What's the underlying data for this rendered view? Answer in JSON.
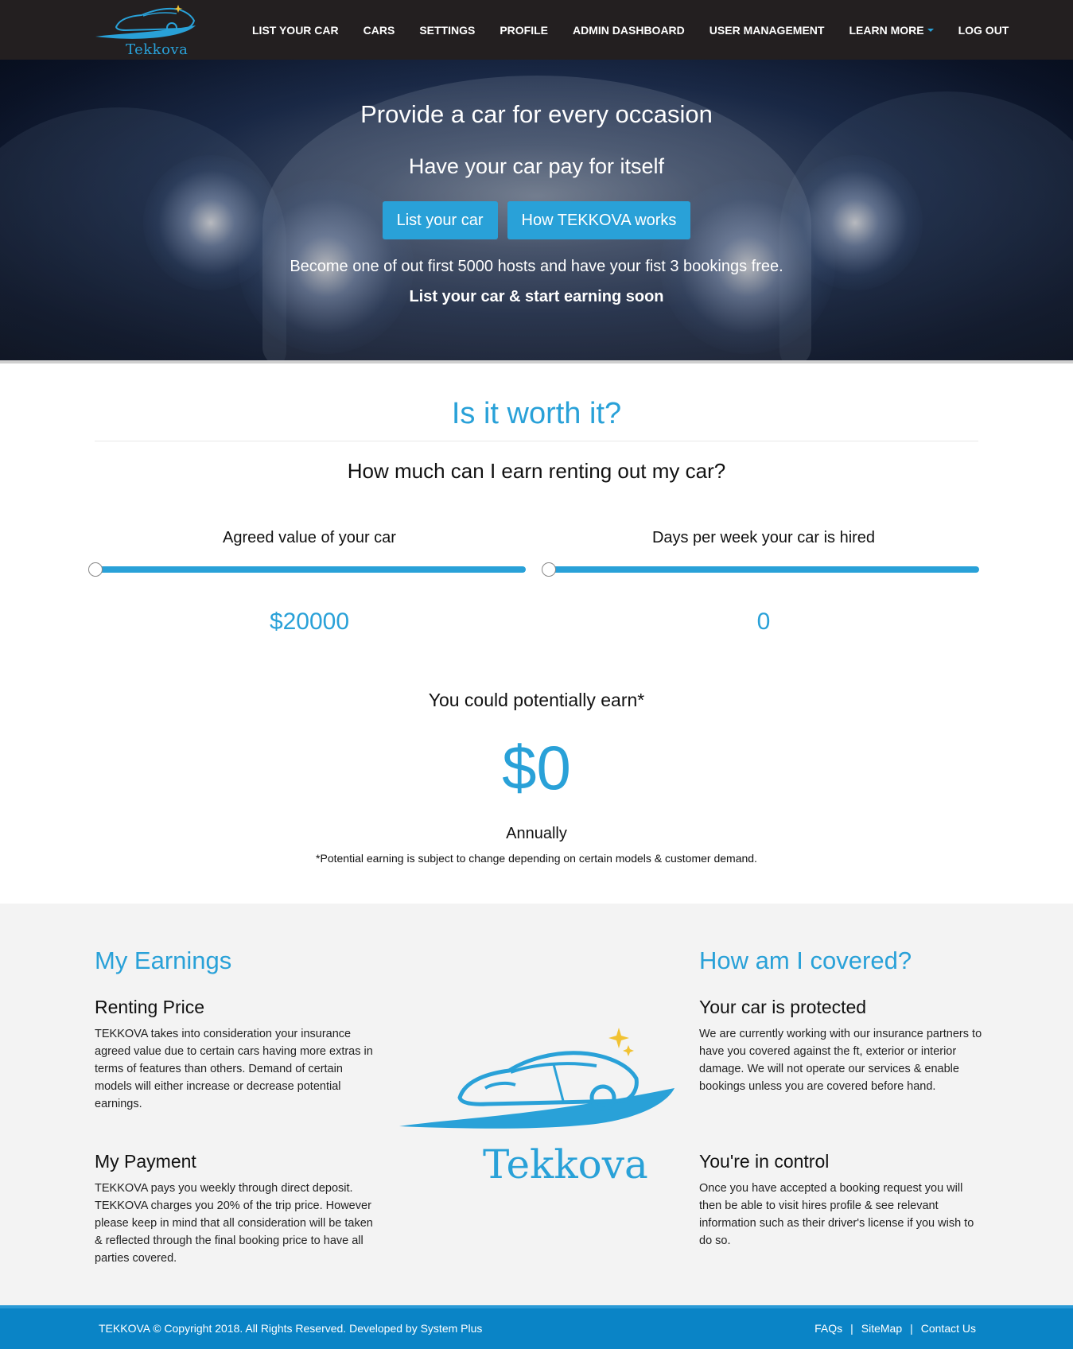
{
  "brand": {
    "name": "Tekkova",
    "color": "#29a1d8"
  },
  "nav": {
    "items": [
      {
        "label": "LIST YOUR CAR"
      },
      {
        "label": "CARS"
      },
      {
        "label": "SETTINGS"
      },
      {
        "label": "PROFILE"
      },
      {
        "label": "ADMIN DASHBOARD"
      },
      {
        "label": "USER MANAGEMENT"
      },
      {
        "label": "LEARN MORE"
      },
      {
        "label": "LOG OUT"
      }
    ]
  },
  "hero": {
    "title": "Provide a car for every occasion",
    "subtitle": "Have your car pay for itself",
    "list_button": "List your car",
    "how_button": "How TEKKOVA works",
    "promo": "Become one of out first 5000 hosts and have your fist 3 bookings free.",
    "cta": "List your car & start earning soon"
  },
  "calculator": {
    "title": "Is it worth it?",
    "question": "How much can I earn renting out my car?",
    "value_slider": {
      "label": "Agreed value of your car",
      "value": "$20000",
      "position_fraction": 0
    },
    "days_slider": {
      "label": "Days per week your car is hired",
      "value": "0",
      "position_fraction": 0
    },
    "earn_label": "You could potentially earn*",
    "earn_amount": "$0",
    "period": "Annually",
    "disclaimer": "*Potential earning is subject to change depending on certain models & customer demand."
  },
  "earnings": {
    "title": "My Earnings",
    "renting_heading": "Renting Price",
    "renting_text": "TEKKOVA takes into consideration your insurance agreed value due to certain cars having more extras in terms of features than others. Demand of certain models will either increase or decrease potential earnings.",
    "payment_heading": "My Payment",
    "payment_text": "TEKKOVA pays you weekly through direct deposit. TEKKOVA charges you 20% of the trip price. However please keep in mind that all consideration will be taken & reflected through the final booking price to have all parties covered."
  },
  "coverage": {
    "title": "How am I covered?",
    "protected_heading": "Your car is protected",
    "protected_text": "We are currently working with our insurance partners to have you covered against the ft, exterior or interior damage. We will not operate our services & enable bookings unless you are covered before hand.",
    "control_heading": "You're in control",
    "control_text": "Once you have accepted a booking request you will then be able to visit hires profile & see relevant information such as their driver's license if you wish to do so."
  },
  "footer": {
    "copyright": "TEKKOVA © Copyright 2018. All Rights Reserved. Developed by System Plus",
    "faqs": "FAQs",
    "sitemap": "SiteMap",
    "contact": "Contact Us",
    "separator": "|"
  }
}
